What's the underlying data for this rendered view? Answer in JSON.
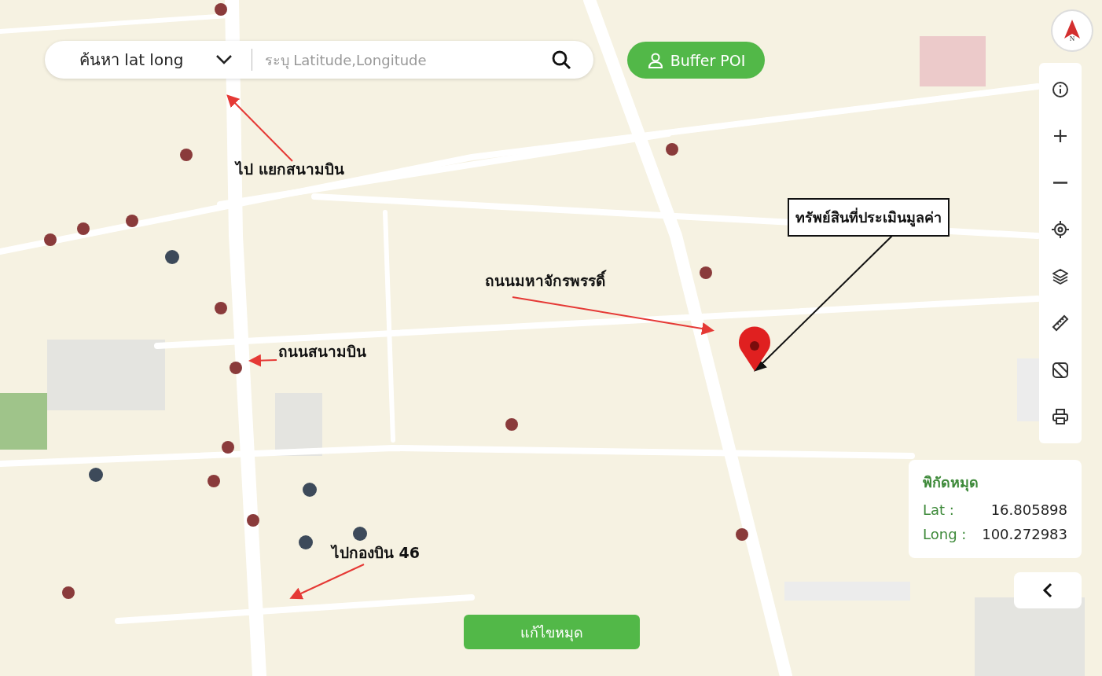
{
  "search": {
    "mode": "ค้นหา lat long",
    "placeholder": "ระบุ Latitude,Longitude"
  },
  "buffer_button": {
    "label": "Buffer POI"
  },
  "compass": {
    "label": "N"
  },
  "annotations": [
    {
      "kind": "plain",
      "text": "ไป แยกสนามบิน"
    },
    {
      "kind": "plain",
      "text": "ถนนสนามบิน"
    },
    {
      "kind": "plain",
      "text": "ถนนมหาจักรพรรดิ์"
    },
    {
      "kind": "boxed",
      "text": "ทรัพย์สินที่ประเมินมูลค่า"
    },
    {
      "kind": "plain",
      "text": "ไปกองบิน 46"
    }
  ],
  "coordinates": {
    "title": "พิกัดหมุด",
    "rows": [
      {
        "label": "Lat :",
        "value": "16.805898"
      },
      {
        "label": "Long :",
        "value": "100.272983"
      }
    ]
  },
  "edit_button": {
    "label": "แก้ไขหมุด"
  }
}
